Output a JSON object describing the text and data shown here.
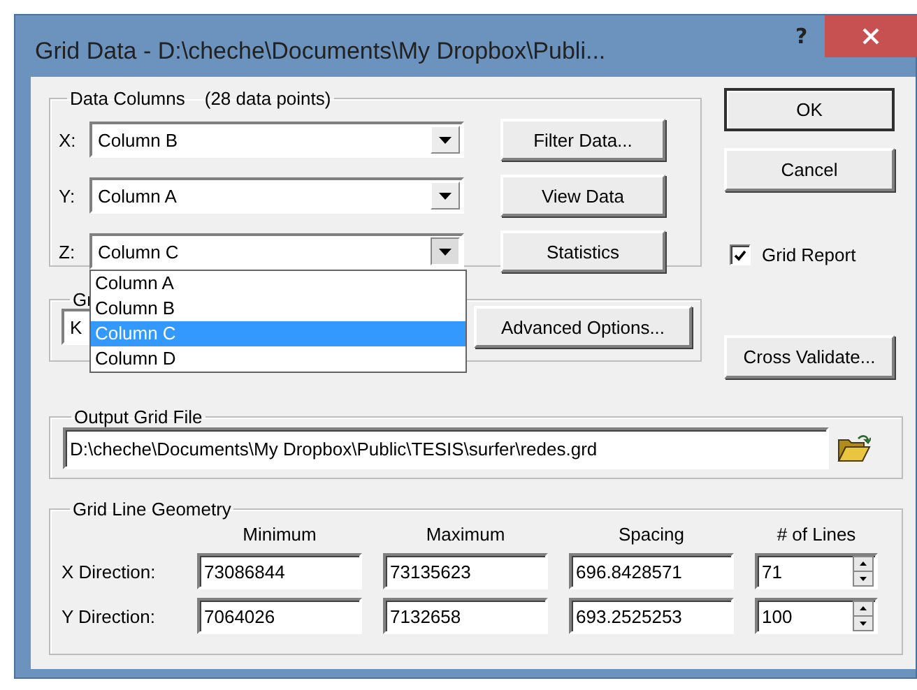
{
  "window": {
    "title": "Grid Data - D:\\cheche\\Documents\\My Dropbox\\Publi...",
    "help": "?"
  },
  "data_columns": {
    "label": "Data Columns",
    "note": "(28 data points)",
    "fields": [
      {
        "axis": "X:",
        "value": "Column B",
        "expanded": false,
        "button": "Filter Data..."
      },
      {
        "axis": "Y:",
        "value": "Column A",
        "expanded": false,
        "button": "View Data"
      },
      {
        "axis": "Z:",
        "value": "Column C",
        "expanded": true,
        "button": "Statistics"
      }
    ],
    "options": [
      {
        "label": "Column A",
        "selected": false
      },
      {
        "label": "Column B",
        "selected": false
      },
      {
        "label": "Column C",
        "selected": true
      },
      {
        "label": "Column D",
        "selected": false
      }
    ]
  },
  "side_buttons": [
    "OK",
    "Cancel"
  ],
  "grid_report": {
    "label": "Grid Report",
    "checked": true
  },
  "cross_validate": "Cross Validate...",
  "gridding_method": {
    "label": "Gr",
    "value": "K",
    "button": "Advanced Options..."
  },
  "output_grid_file": {
    "label": "Output Grid File",
    "value": "D:\\cheche\\Documents\\My Dropbox\\Public\\TESIS\\surfer\\redes.grd"
  },
  "geometry": {
    "label": "Grid Line Geometry",
    "columns": [
      "Minimum",
      "Maximum",
      "Spacing",
      "# of Lines"
    ],
    "rows": [
      {
        "label": "X Direction:",
        "minimum": "73086844",
        "maximum": "73135623",
        "spacing": "696.8428571",
        "lines": "71"
      },
      {
        "label": "Y Direction:",
        "minimum": "7064026",
        "maximum": "7132658",
        "spacing": "693.2525253",
        "lines": "100"
      }
    ]
  }
}
